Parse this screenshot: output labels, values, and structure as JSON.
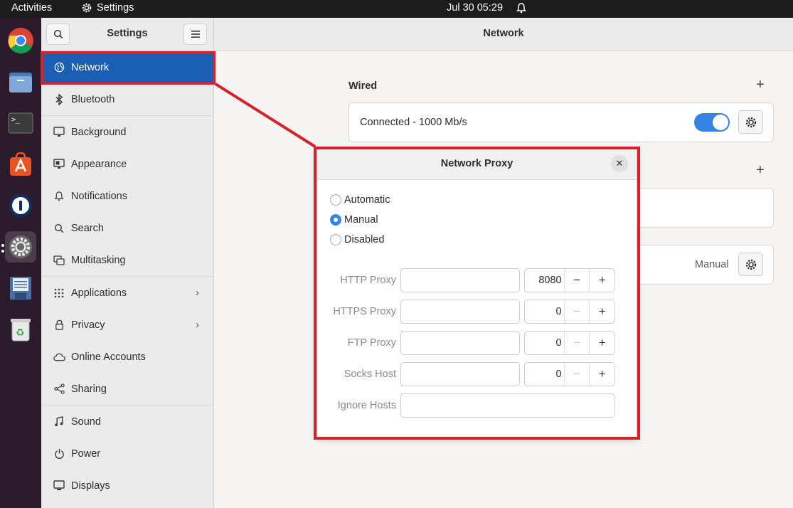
{
  "topbar": {
    "activities": "Activities",
    "app_name": "Settings",
    "clock": "Jul 30  05:29"
  },
  "dock": {
    "items": [
      "chrome-icon",
      "files-icon",
      "terminal-icon",
      "app-center-icon",
      "password-manager-icon",
      "settings-icon",
      "save-icon",
      "trash-icon"
    ]
  },
  "sidebar": {
    "title": "Settings",
    "items": [
      {
        "label": "Network",
        "icon": "globe-icon",
        "selected": true
      },
      {
        "label": "Bluetooth",
        "icon": "bluetooth-icon"
      },
      {
        "label": "Background",
        "icon": "monitor-icon"
      },
      {
        "label": "Appearance",
        "icon": "appearance-icon"
      },
      {
        "label": "Notifications",
        "icon": "bell-icon"
      },
      {
        "label": "Search",
        "icon": "search-icon"
      },
      {
        "label": "Multitasking",
        "icon": "multitasking-icon"
      },
      {
        "label": "Applications",
        "icon": "grid-icon"
      },
      {
        "label": "Privacy",
        "icon": "lock-icon"
      },
      {
        "label": "Online Accounts",
        "icon": "cloud-icon"
      },
      {
        "label": "Sharing",
        "icon": "share-icon"
      },
      {
        "label": "Sound",
        "icon": "music-note-icon"
      },
      {
        "label": "Power",
        "icon": "power-icon"
      },
      {
        "label": "Displays",
        "icon": "display-icon"
      }
    ]
  },
  "main": {
    "title": "Network",
    "wired": {
      "label": "Wired",
      "status": "Connected - 1000 Mb/s",
      "enabled": true
    },
    "proxy_row": {
      "value": "Manual"
    }
  },
  "dialog": {
    "title": "Network Proxy",
    "options": [
      {
        "label": "Automatic",
        "selected": false
      },
      {
        "label": "Manual",
        "selected": true
      },
      {
        "label": "Disabled",
        "selected": false
      }
    ],
    "fields": [
      {
        "label": "HTTP Proxy",
        "value": "",
        "port": "8080"
      },
      {
        "label": "HTTPS Proxy",
        "value": "",
        "port": "0"
      },
      {
        "label": "FTP Proxy",
        "value": "",
        "port": "0"
      },
      {
        "label": "Socks Host",
        "value": "",
        "port": "0"
      }
    ],
    "ignore_hosts": {
      "label": "Ignore Hosts",
      "value": ""
    }
  },
  "colors": {
    "accent": "#1a5fb4",
    "toggle": "#3584e4",
    "annotation": "#d7212b"
  }
}
